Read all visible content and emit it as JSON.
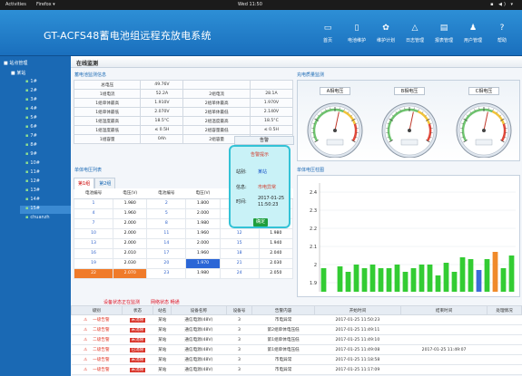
{
  "topbar": {
    "activities": "Activities",
    "app_menu": "Firefox ▾",
    "clock": "Wed 11:50",
    "tray": "▪ ◀) ▾"
  },
  "header": {
    "title": "GT-ACFS48蓄电池组远程充放电系统",
    "nav": [
      {
        "label": "首页",
        "icon": "monitor-icon",
        "glyph": "▭"
      },
      {
        "label": "电池维护",
        "icon": "battery-icon",
        "glyph": "▯"
      },
      {
        "label": "维护计划",
        "icon": "gear-icon",
        "glyph": "✿"
      },
      {
        "label": "日志管理",
        "icon": "warning-icon",
        "glyph": "△"
      },
      {
        "label": "报表管理",
        "icon": "report-icon",
        "glyph": "▤"
      },
      {
        "label": "用户管理",
        "icon": "user-icon",
        "glyph": "♟"
      },
      {
        "label": "帮助",
        "icon": "help-icon",
        "glyph": "?"
      }
    ]
  },
  "sidebar": {
    "root": "站点管理",
    "group": "某站",
    "items": [
      "1#",
      "2#",
      "3#",
      "4#",
      "5#",
      "6#",
      "7#",
      "8#",
      "9#",
      "10#",
      "11#",
      "12#",
      "13#",
      "14#",
      "15#",
      "chuanzh"
    ],
    "selected_index": 14
  },
  "page_title": "在线监测",
  "info": {
    "title": "蓄电池监测信息",
    "rows": [
      [
        "总电压",
        "49.76V",
        "",
        ""
      ],
      [
        "1组电流",
        "52.2A",
        "2组电流",
        "28.1A"
      ],
      [
        "1组单体最高",
        "1.910V",
        "2组单体最高",
        "1.970V"
      ],
      [
        "1组单体最低",
        "2.070V",
        "2组单体最低",
        "2.140V"
      ],
      [
        "1组温度最高",
        "18.5°C",
        "2组温度最高",
        "18.5°C"
      ],
      [
        "1组温度最低",
        "≤ 0.5H",
        "2组容量最低",
        "≤ 0.5H"
      ],
      [
        "1组容量",
        "0Ah",
        "2组容量",
        "0Ah"
      ]
    ]
  },
  "gauges": {
    "title": "充电质量监测",
    "items": [
      {
        "label": "A相电压",
        "value": 0.55
      },
      {
        "label": "B相电压",
        "value": 0.55
      },
      {
        "label": "C相电压",
        "value": 0.55
      }
    ]
  },
  "cells": {
    "title": "单体电压列表",
    "tabs": [
      "第1组",
      "第2组"
    ],
    "headers": [
      "电池编号",
      "电压(V)",
      "电池编号",
      "电压(V)",
      "电池编号",
      "电压(V)"
    ],
    "rows": [
      [
        "1",
        "1.980",
        "2",
        "1.800",
        "3",
        "1.990"
      ],
      [
        "4",
        "1.960",
        "5",
        "2.000",
        "6",
        "1.980"
      ],
      [
        "7",
        "2.000",
        "8",
        "1.980",
        "9",
        "1.980"
      ],
      [
        "10",
        "2.000",
        "11",
        "1.960",
        "12",
        "1.980"
      ],
      [
        "13",
        "2.000",
        "14",
        "2.000",
        "15",
        "1.940"
      ],
      [
        "16",
        "2.010",
        "17",
        "1.960",
        "18",
        "2.040"
      ],
      [
        "19",
        "2.030",
        "20",
        "1.970",
        "21",
        "2.030"
      ],
      [
        "22",
        "2.070",
        "23",
        "1.980",
        "24",
        "2.050"
      ]
    ],
    "high_cells": [
      "22"
    ],
    "low_cells": [
      "20"
    ]
  },
  "chart_data": {
    "type": "bar",
    "title": "单体电压柱图",
    "categories": [
      "1",
      "2",
      "3",
      "4",
      "5",
      "6",
      "7",
      "8",
      "9",
      "10",
      "11",
      "12",
      "13",
      "14",
      "15",
      "16",
      "17",
      "18",
      "19",
      "20",
      "21",
      "22",
      "23",
      "24"
    ],
    "values": [
      1.98,
      1.8,
      1.99,
      1.96,
      2.0,
      1.98,
      2.0,
      1.98,
      1.98,
      2.0,
      1.96,
      1.98,
      2.0,
      2.0,
      1.94,
      2.01,
      1.96,
      2.04,
      2.03,
      1.97,
      2.03,
      2.07,
      1.98,
      2.05
    ],
    "bar_colors": [
      "#33cc33",
      "#33cc33",
      "#33cc33",
      "#33cc33",
      "#33cc33",
      "#33cc33",
      "#33cc33",
      "#33cc33",
      "#33cc33",
      "#33cc33",
      "#33cc33",
      "#33cc33",
      "#33cc33",
      "#33cc33",
      "#33cc33",
      "#33cc33",
      "#33cc33",
      "#33cc33",
      "#33cc33",
      "#3b6bd8",
      "#33cc33",
      "#f08a2a",
      "#33cc33",
      "#33cc33"
    ],
    "yticks": [
      "2.4",
      "2.3",
      "2.2",
      "2.1",
      "2",
      "1.9"
    ],
    "ylim": [
      1.85,
      2.45
    ]
  },
  "alarm_popup": {
    "dialog_title": "告警",
    "title": "告警提示",
    "site_label": "站别:",
    "site_value": "某站",
    "info_label": "信息:",
    "info_value": "市电异常",
    "time_label": "时间:",
    "time_value": "2017-01-25 11:50:23",
    "ok_label": "确定"
  },
  "alarms": {
    "head_left": "设备状态正在监测",
    "head_right": "网络状态 畅通",
    "headers": [
      "级别",
      "状态",
      "站名",
      "设备名称",
      "设备号",
      "告警内容",
      "开始时间",
      "结束时间",
      "处理情况"
    ],
    "rows": [
      [
        "一级告警",
        "未消除",
        "某站",
        "通信电源(48V)",
        "3",
        "市电异常",
        "2017-01-25 11:50:23",
        "",
        ""
      ],
      [
        "二级告警",
        "未消除",
        "某站",
        "通信电源(48V)",
        "3",
        "第2组单体电压低",
        "2017-01-25 11:49:11",
        "",
        ""
      ],
      [
        "二级告警",
        "未消除",
        "某站",
        "通信电源(48V)",
        "3",
        "第1组单体电压低",
        "2017-01-25 11:49:10",
        "",
        ""
      ],
      [
        "二级告警",
        "已消除",
        "某站",
        "通信电源(48V)",
        "3",
        "第1组单体电压低",
        "2017-01-25 11:49:08",
        "2017-01-25 11:49:07",
        ""
      ],
      [
        "一级告警",
        "未消除",
        "某站",
        "通信电源(48V)",
        "3",
        "市电异常",
        "2017-01-25 11:18:58",
        "",
        ""
      ],
      [
        "一级告警",
        "未消除",
        "某站",
        "通信电源(48V)",
        "3",
        "市电异常",
        "2017-01-25 11:17:09",
        "",
        ""
      ]
    ]
  }
}
